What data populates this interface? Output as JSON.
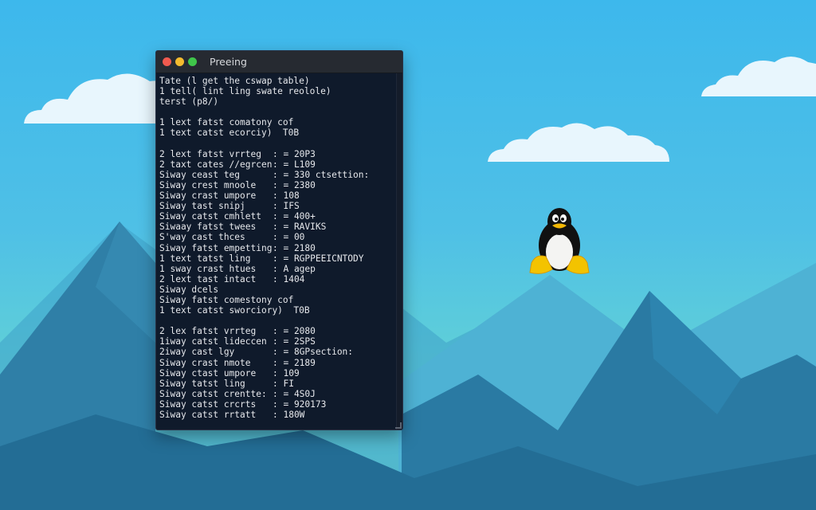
{
  "window": {
    "title": "Preeing",
    "controls": [
      "close",
      "minimize",
      "maximize"
    ]
  },
  "terminal": {
    "header_lines": [
      "Tate (l get the cswap table)",
      "1 tell( lint ling swate reolole)",
      "terst (p8/)"
    ],
    "block1": [
      "1 lext fatst comatony cof",
      "1 text catst ecorciy)  T0B"
    ],
    "table1": [
      {
        "name": "2 lext fatst vrrteg",
        "value": ": = 20P3"
      },
      {
        "name": "2 taxt cates //egrcen",
        "value": ": = L109"
      },
      {
        "name": "Siway ceast teg",
        "value": ": = 330 ctsettion:"
      },
      {
        "name": "Siway crest mnoole",
        "value": ": = 2380"
      },
      {
        "name": "Siway crast umpore",
        "value": ": 108"
      },
      {
        "name": "Siway tast snipj",
        "value": ": IFS"
      },
      {
        "name": "Siway catst cmhlett",
        "value": ": = 400+"
      },
      {
        "name": "Siwaay fatst twees",
        "value": ": = RAVIKS"
      },
      {
        "name": "S'way cast thces",
        "value": ": = 00"
      },
      {
        "name": "Siway fatst empetting",
        "value": ": = 2180"
      },
      {
        "name": "1 text tatst ling",
        "value": ": = RGPPEEICNTODY"
      },
      {
        "name": "1 sway crast htues",
        "value": ": A agep"
      },
      {
        "name": "2 lext tast intact",
        "value": ": 1404"
      }
    ],
    "block2": [
      "Siway dcels",
      "Siway fatst comestony cof",
      "1 text catst sworciory)  T0B"
    ],
    "table2": [
      {
        "name": "2 lex fatst vrrteg",
        "value": ": = 2080"
      },
      {
        "name": "1iway catst lideccen",
        "value": ": = 2SPS"
      },
      {
        "name": "2iway cast lgy",
        "value": ": = 8GPsection:"
      },
      {
        "name": "Siway crast nmote",
        "value": ": = 2189"
      },
      {
        "name": "Siway ctast umpore",
        "value": ": 109"
      },
      {
        "name": "Siway tatst ling",
        "value": ": FI"
      },
      {
        "name": "Siway catst crentte:",
        "value": ": = 4S0J"
      },
      {
        "name": "Siway catst crcrts",
        "value": ": = 920173"
      },
      {
        "name": "Siway catst rrtatt",
        "value": ": 180W"
      }
    ]
  },
  "colors": {
    "terminal_bg": "#0f1a2b",
    "titlebar_bg": "#262a31",
    "close": "#f05a4f",
    "minimize": "#f4bb2f",
    "maximize": "#3fc64a",
    "sky": "#3db8ec",
    "mountain": "#2e7fa6"
  },
  "icons": {
    "mascot": "tux-penguin-icon"
  }
}
